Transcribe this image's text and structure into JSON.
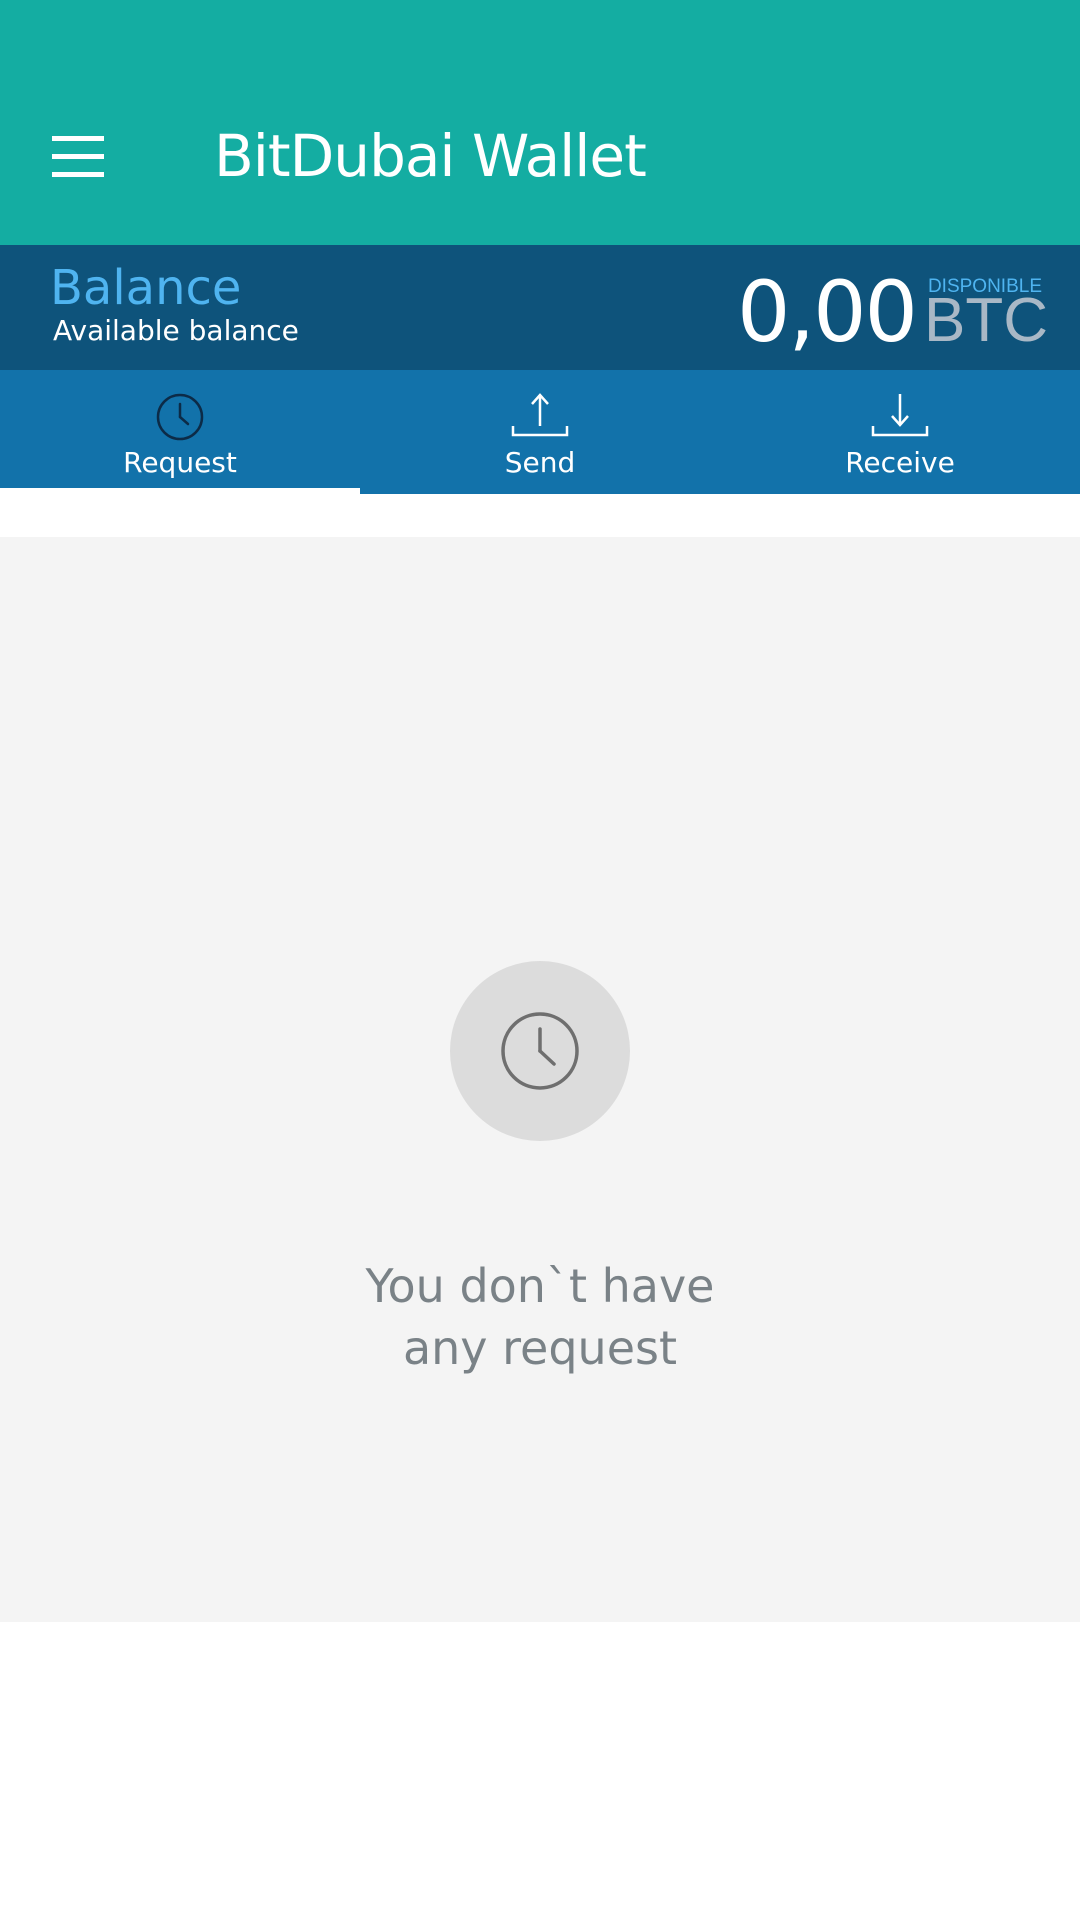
{
  "app_bar": {
    "title": "BitDubai Wallet",
    "menu_icon": "menu-icon",
    "background_color": "#14ada2"
  },
  "balance": {
    "title": "Balance",
    "subtitle": "Available balance",
    "amount": "0,00",
    "status": "DISPONIBLE",
    "currency": "BTC",
    "background_color": "#0e537b",
    "accent_color": "#4fb4f0"
  },
  "tabs": {
    "background_color": "#1272aa",
    "selected": "Request",
    "items": [
      {
        "label": "Request",
        "icon": "clock-icon"
      },
      {
        "label": "Send",
        "icon": "upload-icon"
      },
      {
        "label": "Receive",
        "icon": "download-icon"
      }
    ]
  },
  "empty_state": {
    "icon": "clock-icon",
    "line1": "You don`t have",
    "line2": "any request"
  }
}
